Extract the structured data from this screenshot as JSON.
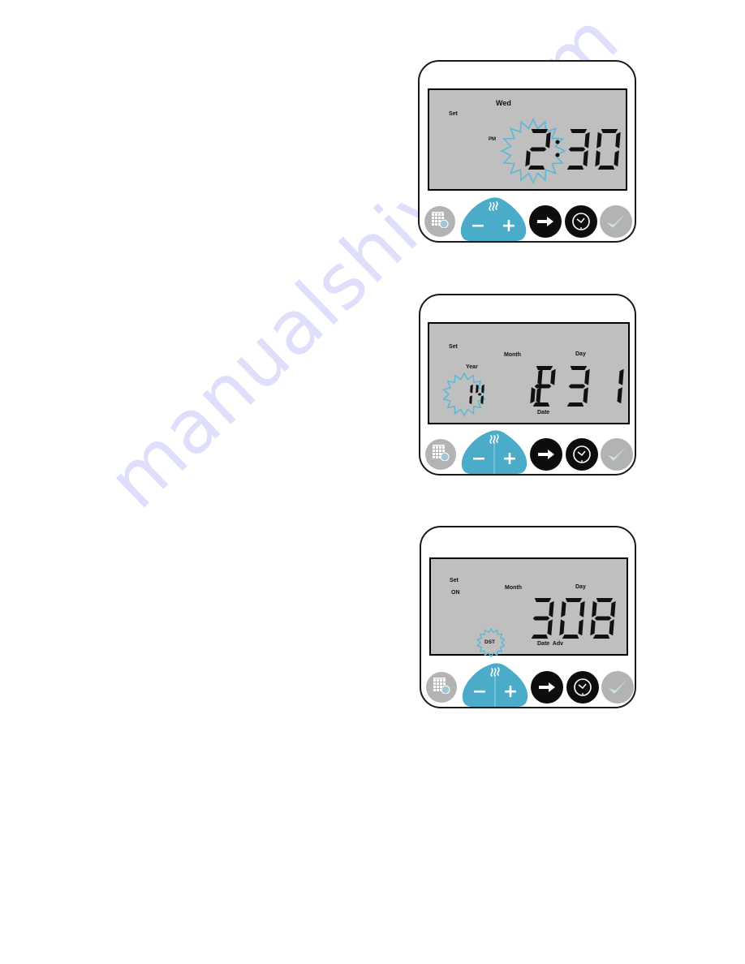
{
  "colors": {
    "accent_blue": "#4AACC8",
    "burst_blue": "#5BB8D8",
    "lcd_bg": "#BFBFBF",
    "button_grey": "#B3B3B3",
    "button_black": "#0D0D0D",
    "segment": "#111111"
  },
  "watermark": "manualshive.com",
  "panels": [
    {
      "name": "time-set",
      "labels": {
        "set": "Set",
        "weekday": "Wed",
        "ampm": "PM"
      },
      "display": {
        "hour": "2",
        "separator": ":",
        "minutes": "30"
      },
      "blinking": "hour"
    },
    {
      "name": "date-set",
      "labels": {
        "set": "Set",
        "year": "Year",
        "month": "Month",
        "day": "Day",
        "date": "Date"
      },
      "display": {
        "year": "14",
        "month": "12",
        "day": "31"
      },
      "blinking": "year"
    },
    {
      "name": "dst-set",
      "labels": {
        "set": "Set",
        "on": "ON",
        "month": "Month",
        "day": "Day",
        "dst": "DST",
        "date_adv": "Date  Adv"
      },
      "display": {
        "month": "3",
        "day": "08"
      },
      "blinking": "DST"
    }
  ],
  "buttons": {
    "calendar": "calendar-clock-icon",
    "steam": "steam-icon",
    "minus": "−",
    "plus": "+",
    "next": "arrow-right-icon",
    "clock": "clock-icon",
    "confirm": "checkmark-icon"
  }
}
